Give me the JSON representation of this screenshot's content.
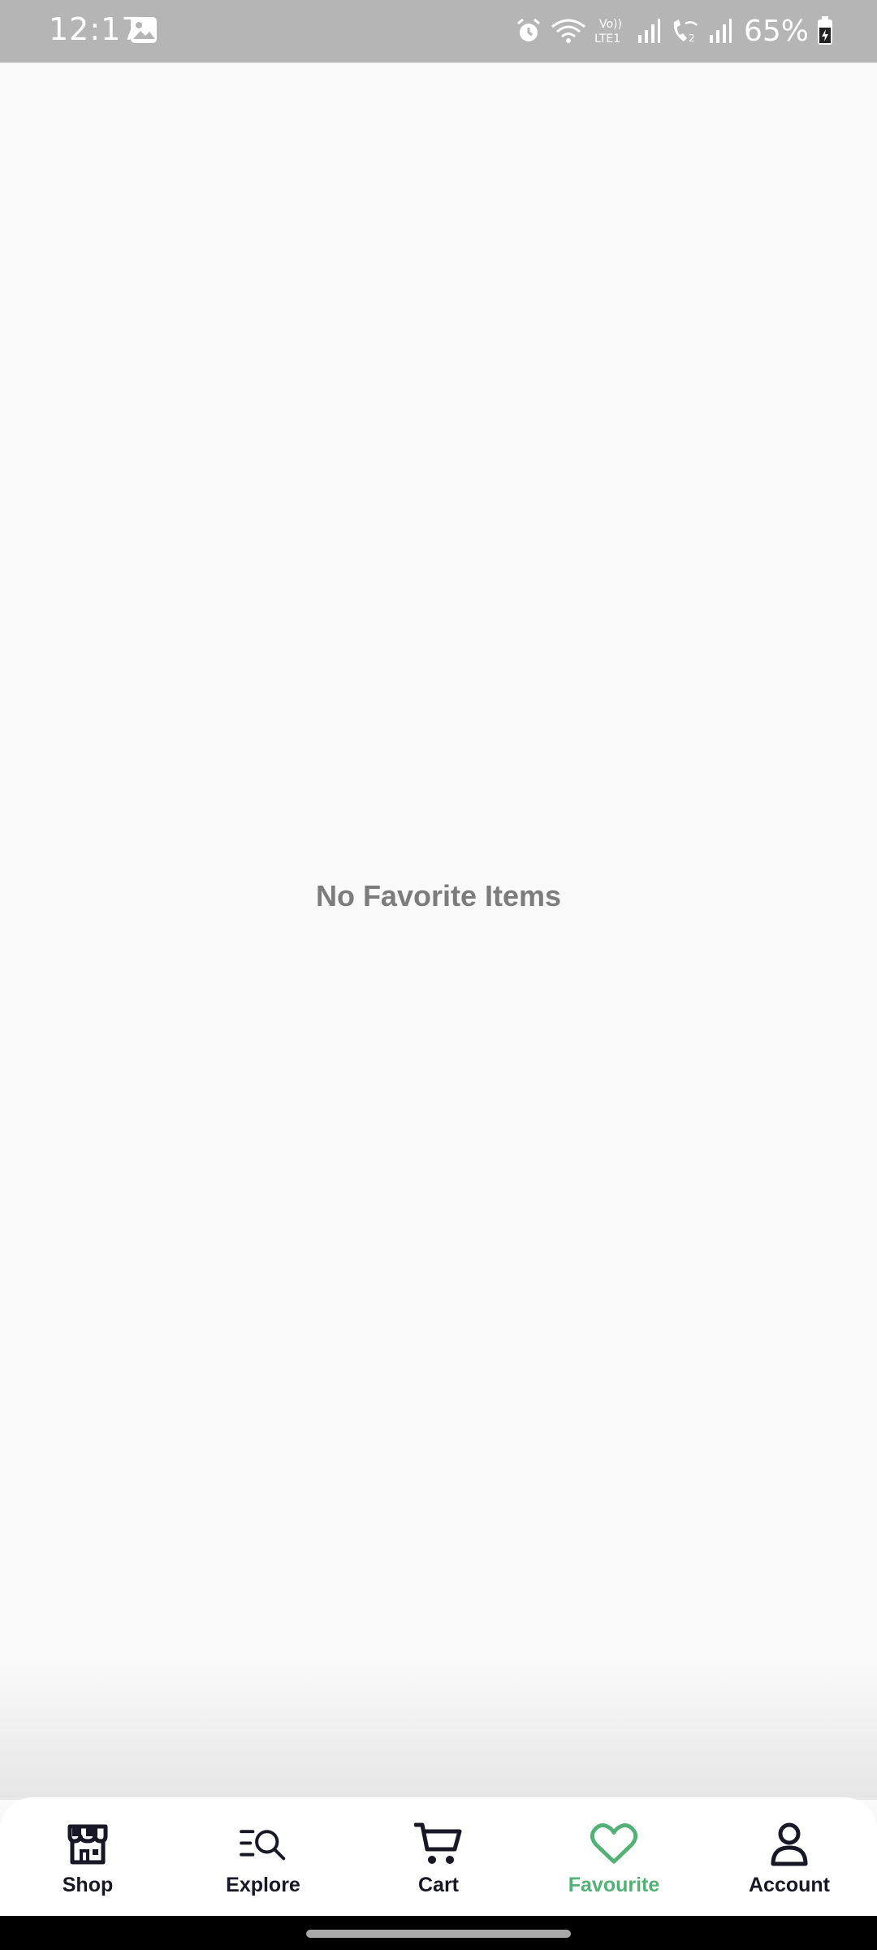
{
  "status_bar": {
    "time": "12:17",
    "battery": "65%",
    "icons": [
      "gallery-icon",
      "alarm-icon",
      "wifi-icon",
      "volte-icon",
      "signal-icon",
      "wifi-calling-icon",
      "signal-2-icon",
      "battery-icon"
    ],
    "volte_text": "Vo)) LTE1"
  },
  "main": {
    "empty_message": "No Favorite Items"
  },
  "bottom_nav": {
    "items": [
      {
        "label": "Shop",
        "icon": "store-icon"
      },
      {
        "label": "Explore",
        "icon": "explore-search-icon"
      },
      {
        "label": "Cart",
        "icon": "cart-icon"
      },
      {
        "label": "Favourite",
        "icon": "heart-icon"
      },
      {
        "label": "Account",
        "icon": "user-icon"
      }
    ],
    "active_index": 3
  },
  "colors": {
    "accent": "#53b175",
    "text_dark": "#181725",
    "empty_text": "#7c7c7c",
    "status_bar_bg": "#b5b5b5"
  }
}
